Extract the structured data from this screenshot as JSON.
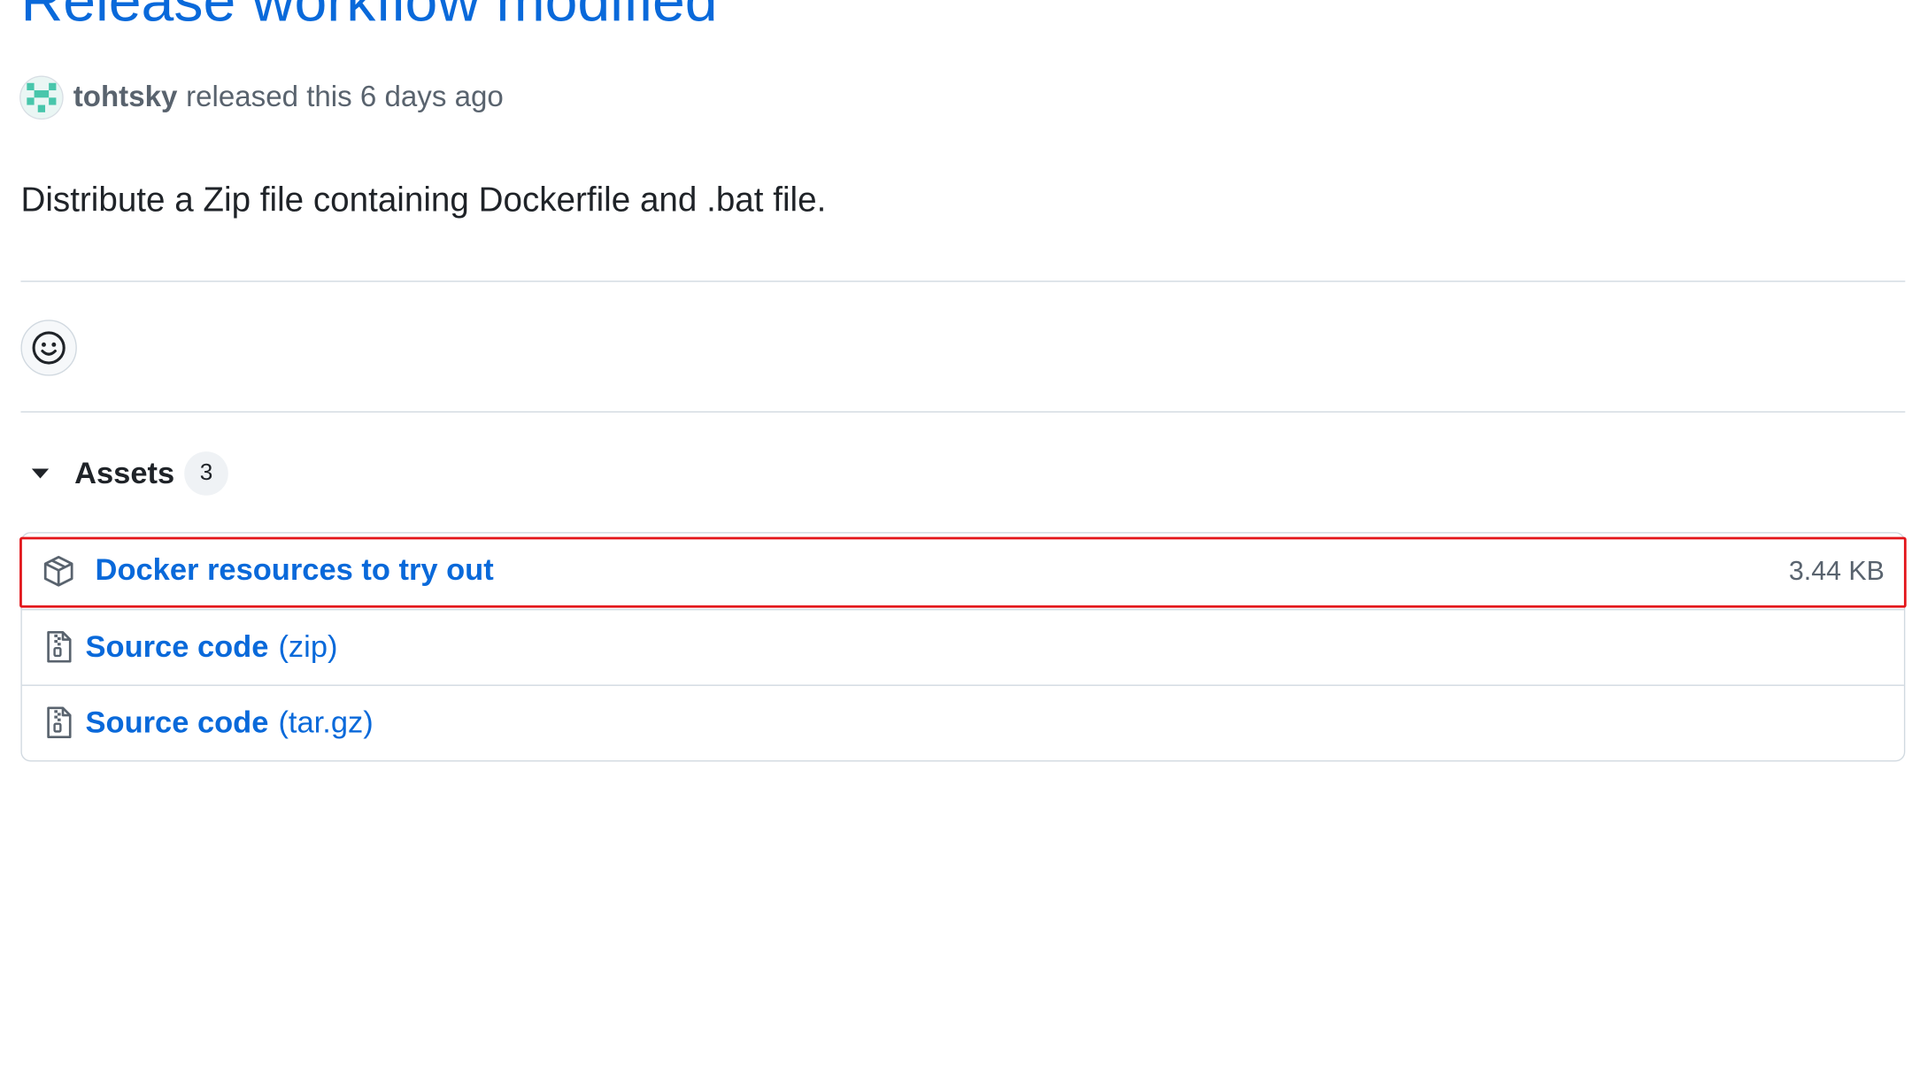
{
  "release": {
    "title": "Release workflow modified",
    "author": "tohtsky",
    "released_text": "released this 6 days ago",
    "description": "Distribute a Zip file containing Dockerfile and .bat file."
  },
  "reactions": {
    "add_icon": "smiley-icon"
  },
  "assets": {
    "label": "Assets",
    "count": "3",
    "items": [
      {
        "name": "Docker resources to try out",
        "ext": "",
        "size": "3.44 KB",
        "icon": "package-icon",
        "highlighted": true
      },
      {
        "name": "Source code",
        "ext": "(zip)",
        "size": "",
        "icon": "file-zip-icon",
        "highlighted": false
      },
      {
        "name": "Source code",
        "ext": "(tar.gz)",
        "size": "",
        "icon": "file-zip-icon",
        "highlighted": false
      }
    ]
  },
  "colors": {
    "link": "#0969da",
    "muted": "#59636e",
    "border": "#d1d9e0",
    "highlight": "#e3151a",
    "avatar_teal": "#48c6ab"
  }
}
